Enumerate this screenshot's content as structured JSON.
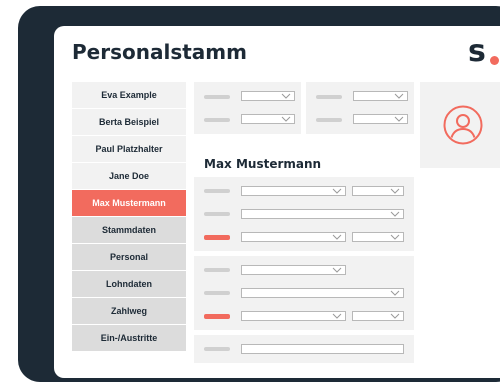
{
  "app": {
    "title": "Personalstamm",
    "logo": "s"
  },
  "sidebar": {
    "items": [
      {
        "label": "Eva Example",
        "kind": "person"
      },
      {
        "label": "Berta Beispiel",
        "kind": "person"
      },
      {
        "label": "Paul Platzhalter",
        "kind": "person"
      },
      {
        "label": "Jane Doe",
        "kind": "person"
      },
      {
        "label": "Max Mustermann",
        "kind": "active"
      },
      {
        "label": "Stammdaten",
        "kind": "section"
      },
      {
        "label": "Personal",
        "kind": "section"
      },
      {
        "label": "Lohndaten",
        "kind": "section"
      },
      {
        "label": "Zahlweg",
        "kind": "section"
      },
      {
        "label": "Ein-/Austritte",
        "kind": "section"
      }
    ]
  },
  "main": {
    "selected_name": "Max Mustermann"
  },
  "colors": {
    "accent": "#f26b5e",
    "dark": "#1d2a36",
    "panel": "#f2f2f2"
  },
  "icons": {
    "avatar": "user-circle-icon",
    "dropdown": "chevron-down-icon"
  }
}
